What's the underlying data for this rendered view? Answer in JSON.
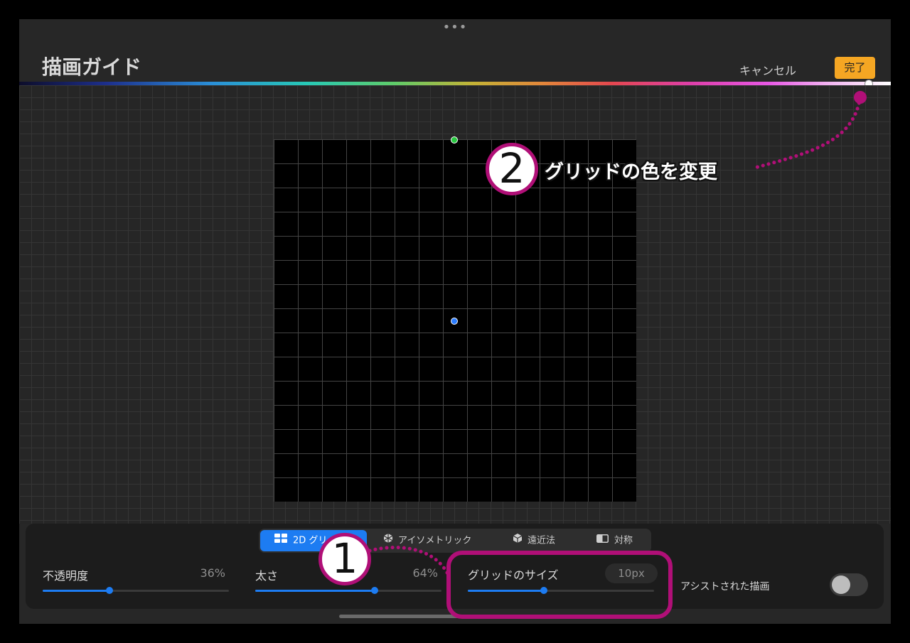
{
  "header": {
    "more_dots": "•••",
    "title": "描画ガイド",
    "cancel_label": "キャンセル",
    "done_label": "完了"
  },
  "colors": {
    "accent": "#1d7cf2",
    "done_button": "#f5a623",
    "annotation": "#b00f77"
  },
  "color_picker": {
    "selected_hue_position": 0.975
  },
  "tabs": [
    {
      "label": "2D グリッド",
      "icon": "grid-icon",
      "selected": true
    },
    {
      "label": "アイソメトリック",
      "icon": "isometric-icon",
      "selected": false
    },
    {
      "label": "遠近法",
      "icon": "perspective-icon",
      "selected": false
    },
    {
      "label": "対称",
      "icon": "symmetry-icon",
      "selected": false
    }
  ],
  "sliders": {
    "opacity": {
      "label": "不透明度",
      "value": "36%",
      "level": 0.36
    },
    "thickness": {
      "label": "太さ",
      "value": "64%",
      "level": 0.64
    },
    "grid_size": {
      "label": "グリッドのサイズ",
      "value": "10px",
      "level": 0.41
    }
  },
  "assist": {
    "label": "アシストされた描画",
    "enabled": false
  },
  "annotations": {
    "one": {
      "number": "1"
    },
    "two": {
      "number": "2",
      "text": "グリッドの色を変更"
    }
  }
}
